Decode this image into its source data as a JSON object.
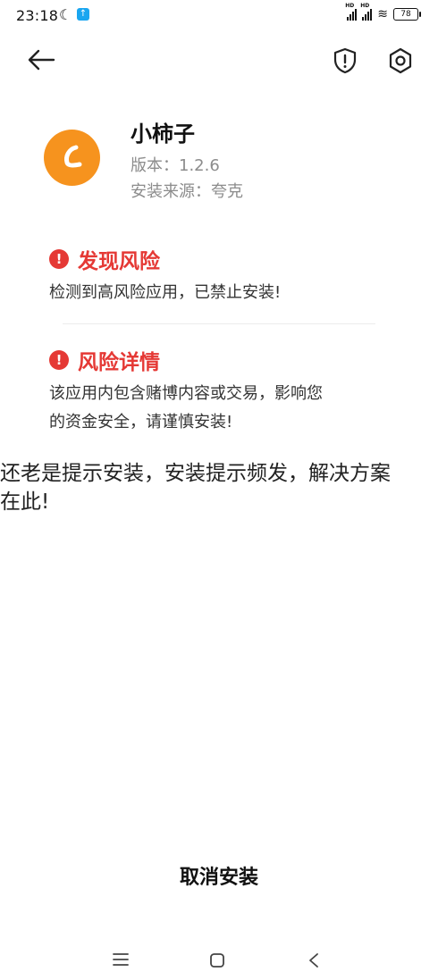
{
  "status_bar": {
    "time": "23:18",
    "battery": "78"
  },
  "app": {
    "name": "小柿子",
    "version": "版本：1.2.6",
    "source": "安装来源：夸克"
  },
  "risk_found": {
    "title": "发现风险",
    "text": "检测到高风险应用，已禁止安装!"
  },
  "risk_detail": {
    "title": "风险详情",
    "line1": "该应用内包含赌博内容或交易，影响您",
    "line2": "的资金安全，请谨慎安装!"
  },
  "overlay": {
    "line1": "还老是提示安装，安装提示频发，解决方案",
    "line2": "在此!"
  },
  "actions": {
    "cancel_label": "取消安装"
  },
  "colors": {
    "accent_red": "#e53935",
    "app_icon_orange": "#f6931e",
    "muted_text": "#8c8c8c"
  },
  "icons": [
    "back-arrow-icon",
    "shield-icon",
    "gear-icon",
    "warning-icon",
    "menu-icon",
    "home-icon",
    "nav-back-icon"
  ]
}
